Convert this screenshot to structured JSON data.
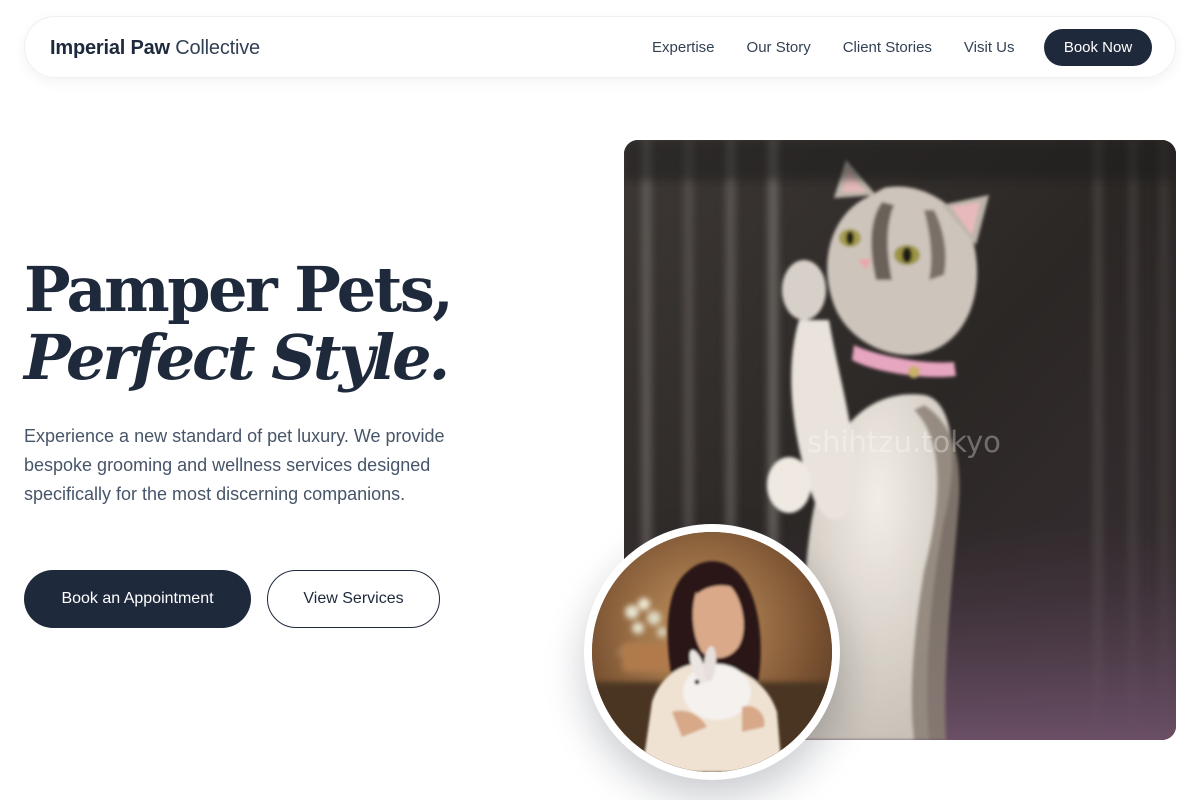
{
  "nav": {
    "brand_bold": "Imperial Paw",
    "brand_light": "Collective",
    "links": [
      "Expertise",
      "Our Story",
      "Client Stories",
      "Visit Us"
    ],
    "cta": "Book Now"
  },
  "hero": {
    "title_line1": "Pamper Pets,",
    "title_line2": "Perfect Style.",
    "description": "Experience a new standard of pet luxury. We provide bespoke grooming and wellness services designed specifically for the most discerning companions.",
    "primary_button": "Book an Appointment",
    "secondary_button": "View Services"
  },
  "images": {
    "main_watermark": "shihtzu.tokyo"
  },
  "colors": {
    "primary": "#1e293b",
    "text_muted": "#475569",
    "background": "#ffffff"
  }
}
